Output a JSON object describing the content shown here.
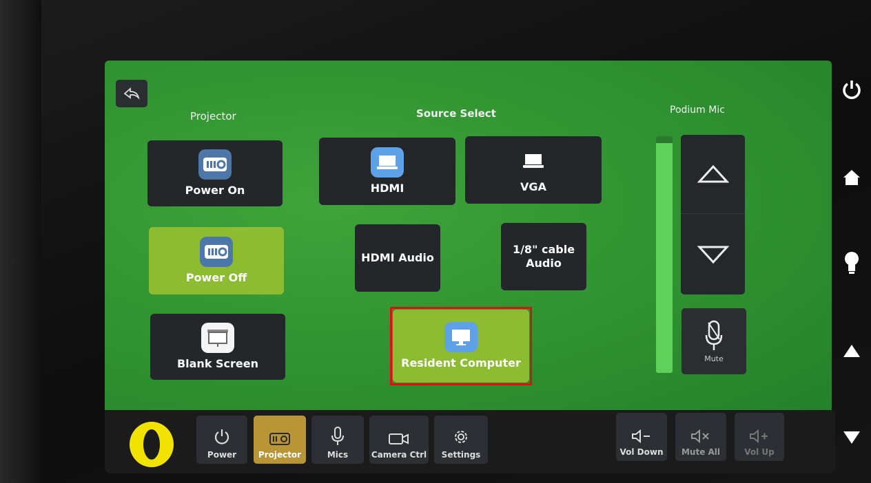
{
  "screen": {
    "projector_label": "Projector",
    "source_label": "Source Select",
    "podium_label": "Podium Mic"
  },
  "projector": {
    "power_on": "Power On",
    "power_off": "Power Off",
    "blank_screen": "Blank Screen"
  },
  "sources": {
    "hdmi": "HDMI",
    "vga": "VGA",
    "hdmi_audio": "HDMI Audio",
    "cable_audio_line1": "1/8\" cable",
    "cable_audio_line2": "Audio",
    "resident": "Resident Computer"
  },
  "podium": {
    "mute": "Mute",
    "level": 0.97
  },
  "nav": {
    "power": "Power",
    "projector": "Projector",
    "mics": "Mics",
    "camera": "Camera Ctrl",
    "settings": "Settings",
    "vol_down": "Vol Down",
    "mute_all": "Mute All",
    "vol_up": "Vol Up"
  },
  "colors": {
    "screen_green": "#2f9130",
    "active_lime": "#8dbb32",
    "active_gold": "#b89638",
    "logo_yellow": "#f1e200"
  },
  "icons": [
    "back-icon",
    "projector-icon",
    "laptop-icon",
    "screen-icon",
    "monitor-icon",
    "arrow-up-icon",
    "arrow-down-icon",
    "microphone-icon",
    "power-icon",
    "gear-icon",
    "camera-icon",
    "speaker-minus-icon",
    "speaker-mute-icon",
    "speaker-plus-icon",
    "home-icon",
    "lightbulb-icon",
    "triangle-up-icon",
    "triangle-down-icon"
  ]
}
